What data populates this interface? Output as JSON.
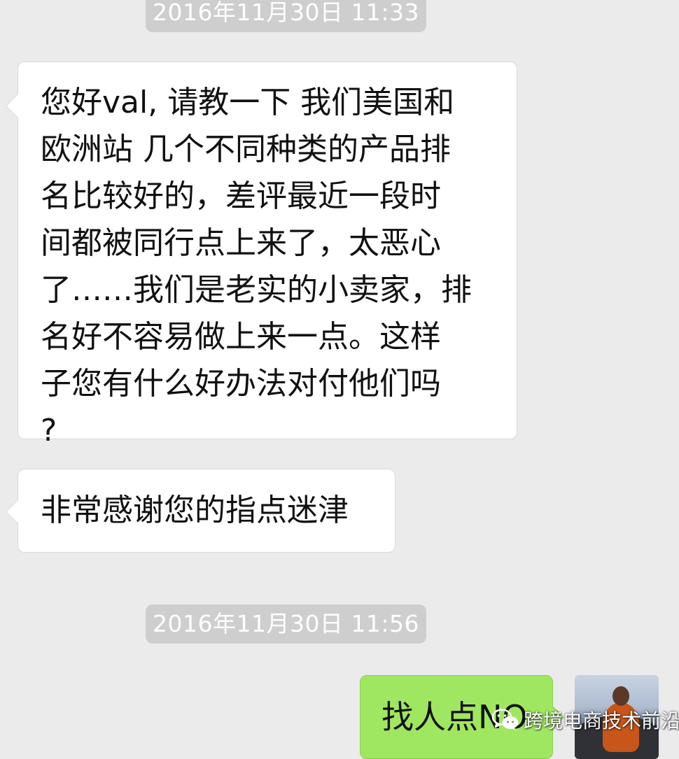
{
  "chat": {
    "timestamps": [
      "2016年11月30日 11:33",
      "2016年11月30日 11:56"
    ],
    "messages": [
      {
        "sender": "other",
        "text": "您好val, 请教一下 我们美国和\n欧洲站 几个不同种类的产品排\n名比较好的，差评最近一段时\n间都被同行点上来了，太恶心\n了……我们是老实的小卖家，排\n名好不容易做上来一点。这样\n子您有什么好办法对付他们吗\n?"
      },
      {
        "sender": "other",
        "text": "非常感谢您的指点迷津"
      },
      {
        "sender": "me",
        "text": "找人点NO"
      }
    ]
  },
  "watermark": {
    "text": "跨境电商技术前沿",
    "icon": "wechat-icon"
  },
  "avatar": {
    "icon": "avatar-meditating-monk"
  },
  "colors": {
    "background": "#ebebeb",
    "timestamp_pill": "#cecece",
    "bubble_received": "#ffffff",
    "bubble_sent": "#9fe760"
  }
}
